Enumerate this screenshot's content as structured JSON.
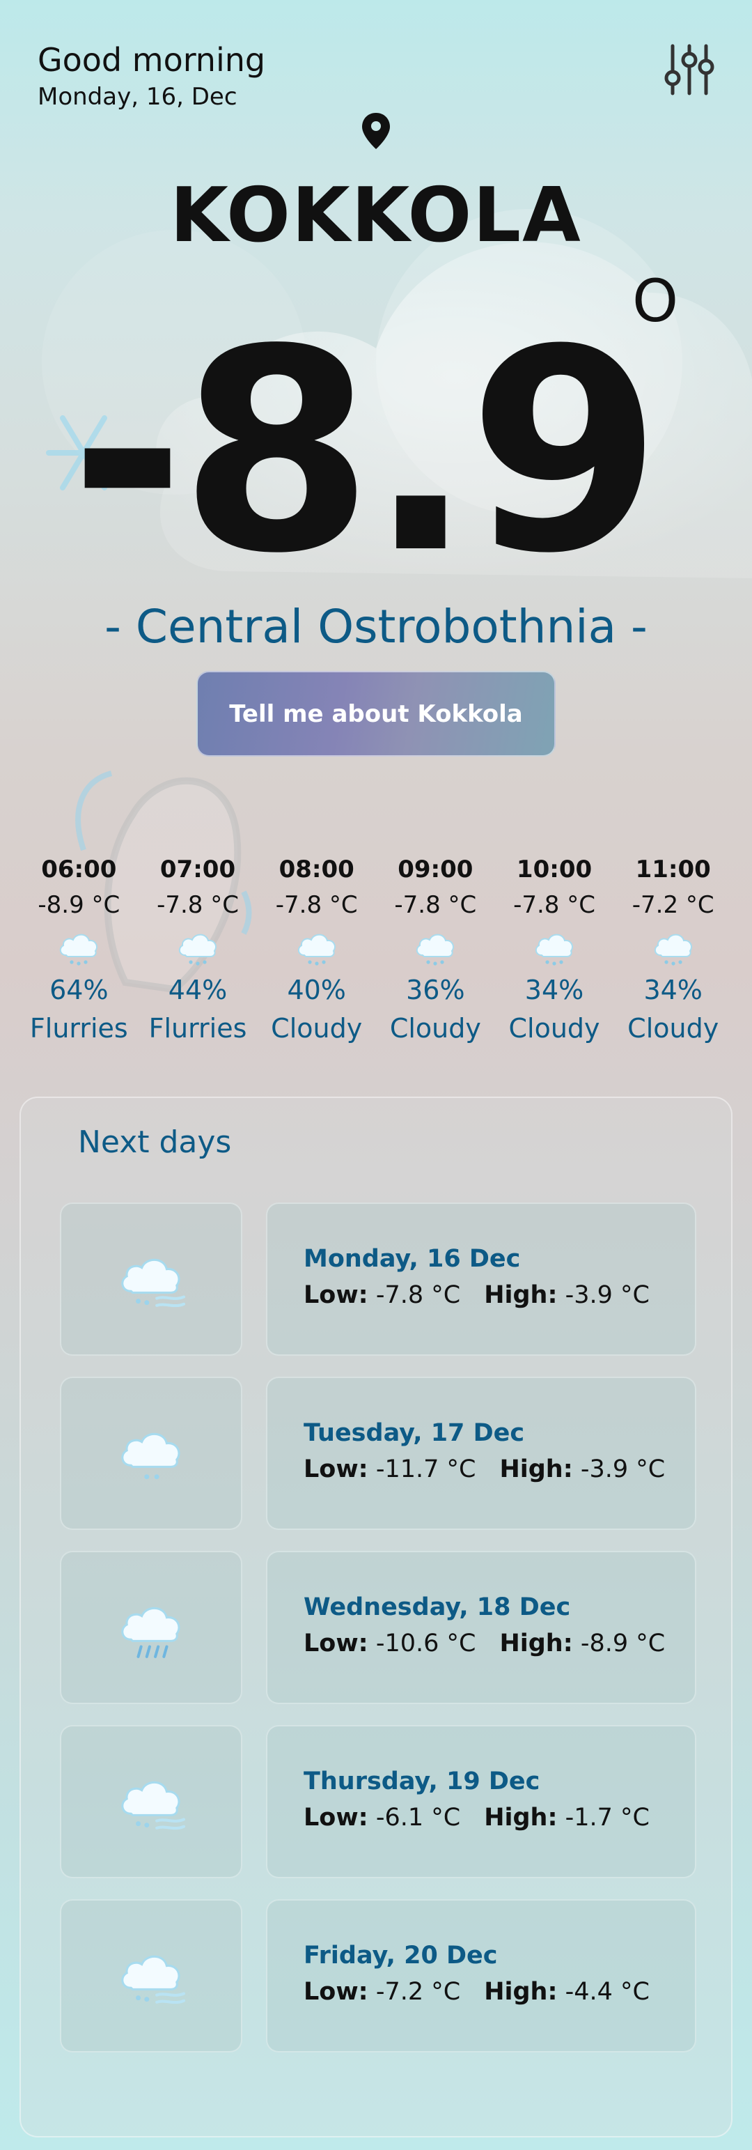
{
  "greeting": {
    "title": "Good morning",
    "date": "Monday, 16, Dec"
  },
  "location": {
    "city": "KOKKOLA",
    "region": "- Central Ostrobothnia -"
  },
  "current": {
    "temperature": "-8.9",
    "degree_symbol": "O"
  },
  "tell_button": {
    "label": "Tell me about  Kokkola"
  },
  "hourly": [
    {
      "time": "06:00",
      "temp": "-8.9 °C",
      "pct": "64%",
      "cond": "Flurries",
      "icon": "snow-cloud-icon"
    },
    {
      "time": "07:00",
      "temp": "-7.8 °C",
      "pct": "44%",
      "cond": "Flurries",
      "icon": "snow-cloud-icon"
    },
    {
      "time": "08:00",
      "temp": "-7.8 °C",
      "pct": "40%",
      "cond": "Cloudy",
      "icon": "snow-cloud-icon"
    },
    {
      "time": "09:00",
      "temp": "-7.8 °C",
      "pct": "36%",
      "cond": "Cloudy",
      "icon": "snow-cloud-icon"
    },
    {
      "time": "10:00",
      "temp": "-7.8 °C",
      "pct": "34%",
      "cond": "Cloudy",
      "icon": "snow-cloud-icon"
    },
    {
      "time": "11:00",
      "temp": "-7.2 °C",
      "pct": "34%",
      "cond": "Cloudy",
      "icon": "snow-cloud-icon"
    }
  ],
  "next_days": {
    "title": "Next days",
    "low_label": "Low:",
    "high_label": "High:",
    "days": [
      {
        "name": "Monday, 16 Dec",
        "low": "-7.8 °C",
        "high": "-3.9 °C",
        "icon": "snow-wind-cloud-icon"
      },
      {
        "name": "Tuesday, 17 Dec",
        "low": "-11.7 °C",
        "high": "-3.9 °C",
        "icon": "snow-cloud-icon"
      },
      {
        "name": "Wednesday, 18 Dec",
        "low": "-10.6 °C",
        "high": "-8.9 °C",
        "icon": "rain-cloud-icon"
      },
      {
        "name": "Thursday, 19 Dec",
        "low": "-6.1 °C",
        "high": "-1.7 °C",
        "icon": "snow-wind-cloud-icon"
      },
      {
        "name": "Friday, 20 Dec",
        "low": "-7.2 °C",
        "high": "-4.4 °C",
        "icon": "snow-wind-cloud-icon"
      }
    ]
  },
  "colors": {
    "accent": "#0d5a86",
    "button": "#8584b6"
  }
}
